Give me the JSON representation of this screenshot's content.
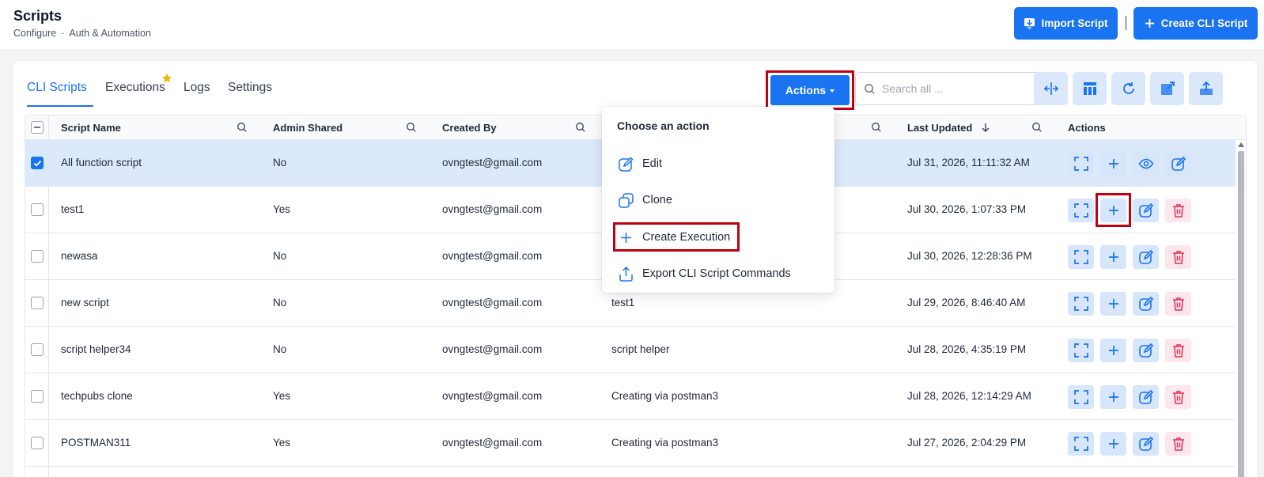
{
  "header": {
    "title": "Scripts",
    "breadcrumb": [
      "Configure",
      "Auth & Automation"
    ],
    "breadcrumb_sep": "-",
    "import_label": "Import Script",
    "create_label": "Create CLI Script"
  },
  "tabs": [
    {
      "label": "CLI Scripts",
      "active": true
    },
    {
      "label": "Executions",
      "active": false
    },
    {
      "label": "Logs",
      "active": false
    },
    {
      "label": "Settings",
      "active": false
    }
  ],
  "toolbar": {
    "actions_label": "Actions",
    "search_placeholder": "Search all ...",
    "tools": [
      "split-columns-icon",
      "table-layout-icon",
      "refresh-icon",
      "external-link-icon",
      "upload-icon"
    ]
  },
  "table": {
    "columns": [
      "Script Name",
      "Admin Shared",
      "Created By",
      "Last Updated",
      "Actions"
    ],
    "rows": [
      {
        "name": "All function script",
        "shared": "No",
        "created_by": "ovngtest@gmail.com",
        "description": "",
        "updated": "Jul 31, 2026, 11:11:32 AM",
        "selected": true
      },
      {
        "name": "test1",
        "shared": "Yes",
        "created_by": "ovngtest@gmail.com",
        "description": "",
        "updated": "Jul 30, 2026, 1:07:33 PM",
        "selected": false
      },
      {
        "name": "newasa",
        "shared": "No",
        "created_by": "ovngtest@gmail.com",
        "description": "",
        "updated": "Jul 30, 2026, 12:28:36 PM",
        "selected": false
      },
      {
        "name": "new script",
        "shared": "No",
        "created_by": "ovngtest@gmail.com",
        "description": "test1",
        "updated": "Jul 29, 2026, 8:46:40 AM",
        "selected": false
      },
      {
        "name": "script helper34",
        "shared": "No",
        "created_by": "ovngtest@gmail.com",
        "description": "script helper",
        "updated": "Jul 28, 2026, 4:35:19 PM",
        "selected": false
      },
      {
        "name": "techpubs clone",
        "shared": "Yes",
        "created_by": "ovngtest@gmail.com",
        "description": "Creating via postman3",
        "updated": "Jul 28, 2026, 12:14:29 AM",
        "selected": false
      },
      {
        "name": "POSTMAN311",
        "shared": "Yes",
        "created_by": "ovngtest@gmail.com",
        "description": "Creating via postman3",
        "updated": "Jul 27, 2026, 2:04:29 PM",
        "selected": false
      }
    ]
  },
  "dropdown": {
    "title": "Choose an action",
    "items": [
      {
        "label": "Edit",
        "icon": "edit-icon"
      },
      {
        "label": "Clone",
        "icon": "clone-icon"
      },
      {
        "label": "Create Execution",
        "icon": "plus-icon"
      },
      {
        "label": "Export CLI Script Commands",
        "icon": "export-icon"
      }
    ]
  },
  "colors": {
    "accent": "#1a73f0",
    "highlight": "#c00010",
    "danger": "#e1305a",
    "star": "#f5b400"
  }
}
